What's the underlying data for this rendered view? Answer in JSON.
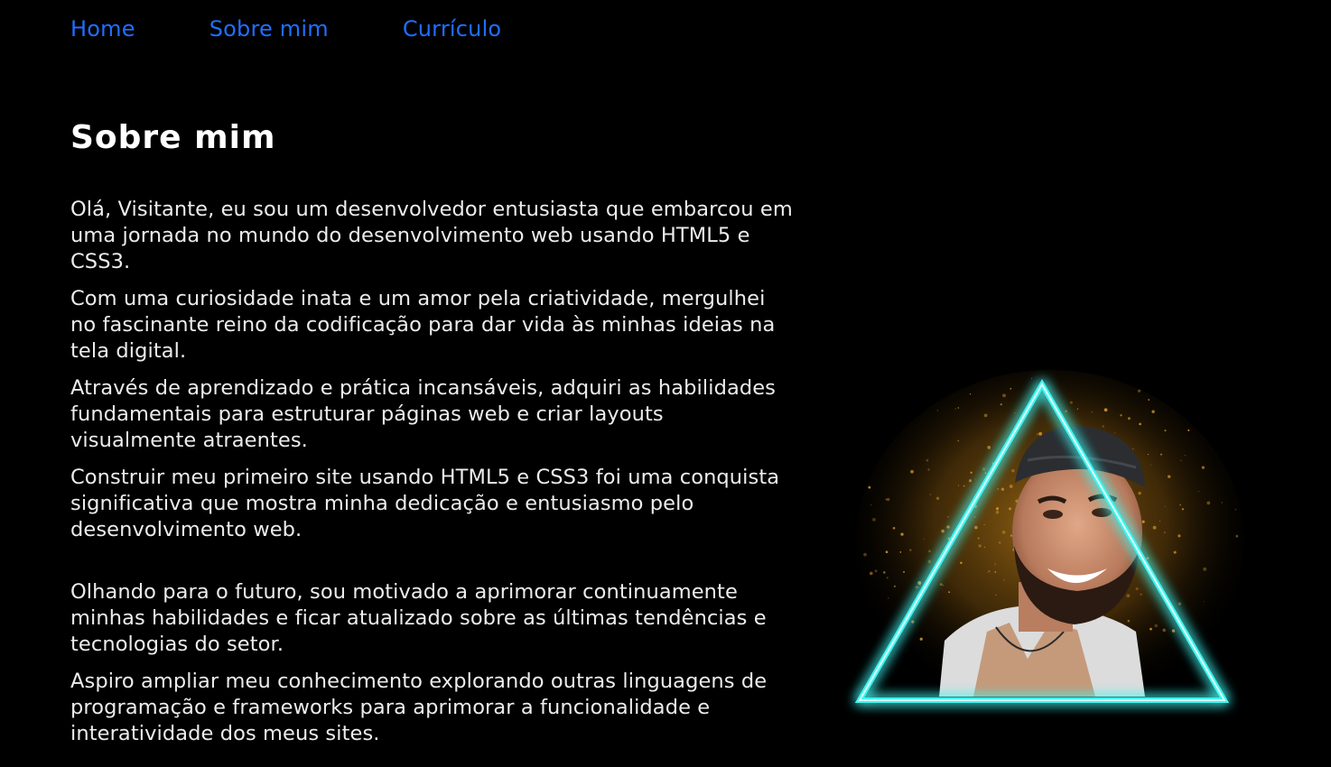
{
  "nav": {
    "items": [
      "Home",
      "Sobre mim",
      "Currículo"
    ]
  },
  "page": {
    "title": "Sobre mim"
  },
  "paragraphs": [
    "Olá, Visitante, eu sou um desenvolvedor entusiasta que embarcou em uma jornada no mundo do desenvolvimento web usando HTML5 e CSS3.",
    "Com uma curiosidade inata e um amor pela criatividade, mergulhei no fascinante reino da codificação para dar vida às minhas ideias na tela digital.",
    "Através de aprendizado e prática incansáveis, adquiri as habilidades fundamentais para estruturar páginas web e criar layouts visualmente atraentes.",
    "Construir meu primeiro site usando HTML5 e CSS3 foi uma conquista significativa que mostra minha dedicação e entusiasmo pelo desenvolvimento web.",
    "Olhando para o futuro, sou motivado a aprimorar continuamente minhas habilidades e ficar atualizado sobre as últimas tendências e tecnologias do setor.",
    "Aspiro ampliar meu conhecimento explorando outras linguagens de programação e frameworks para aprimorar a funcionalidade e interatividade dos meus sites."
  ],
  "colors": {
    "background": "#000000",
    "nav_link": "#1f6fff",
    "text": "#ececec",
    "neon": "#3ff4f0",
    "particles": "#c8861a"
  }
}
